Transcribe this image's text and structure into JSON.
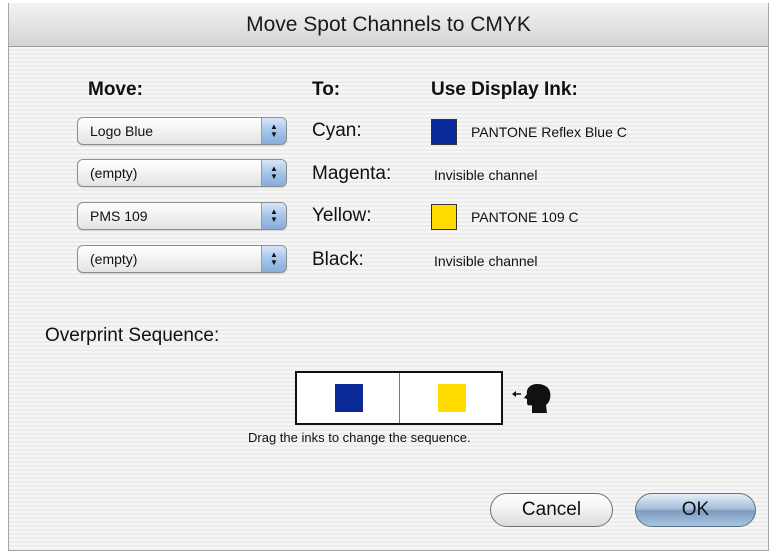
{
  "window": {
    "title": "Move Spot Channels to CMYK"
  },
  "headers": {
    "move": "Move:",
    "to": "To:",
    "display_ink": "Use Display Ink:"
  },
  "rows": [
    {
      "popup_value": "Logo Blue",
      "plate": "Cyan:",
      "ink": "PANTONE Reflex Blue C",
      "swatch_color": "#0a2a9a"
    },
    {
      "popup_value": "(empty)",
      "plate": "Magenta:",
      "ink": "Invisible channel",
      "swatch_color": null
    },
    {
      "popup_value": "PMS 109",
      "plate": "Yellow:",
      "ink": "PANTONE 109 C",
      "swatch_color": "#ffdc00"
    },
    {
      "popup_value": "(empty)",
      "plate": "Black:",
      "ink": "Invisible channel",
      "swatch_color": null
    }
  ],
  "overprint": {
    "label": "Overprint Sequence:",
    "inks": [
      {
        "color": "#0a2a9a"
      },
      {
        "color": "#ffdc00"
      }
    ],
    "hint": "Drag the inks to change the sequence.",
    "indicator_icon": "viewer-head-icon"
  },
  "buttons": {
    "cancel": "Cancel",
    "ok": "OK"
  }
}
